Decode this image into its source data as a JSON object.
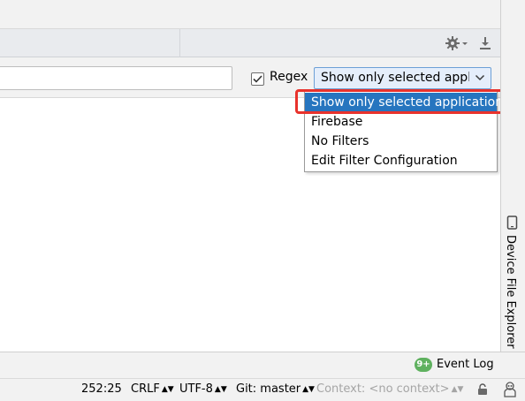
{
  "filter_bar": {
    "search_value": "",
    "regex_label": "Regex",
    "regex_checked": true,
    "selected_filter": "Show only selected application"
  },
  "dropdown": {
    "options": [
      "Show only selected application",
      "Firebase",
      "No Filters",
      "Edit Filter Configuration"
    ],
    "selected_index": 0
  },
  "right_tool_window": {
    "label": "Device File Explorer"
  },
  "event_log": {
    "badge": "9+",
    "label": "Event Log"
  },
  "status_bar": {
    "position": "252:25",
    "line_separator": "CRLF",
    "encoding": "UTF-8",
    "git": "Git: master",
    "context": "Context: <no context>"
  },
  "colors": {
    "selection": "#2675bf",
    "highlight_border": "#e8322c",
    "badge": "#5fb15f"
  },
  "icons": [
    "gear-icon",
    "download-icon",
    "chevron-down-icon",
    "device-icon",
    "lock-icon",
    "inspector-icon",
    "check-icon"
  ]
}
